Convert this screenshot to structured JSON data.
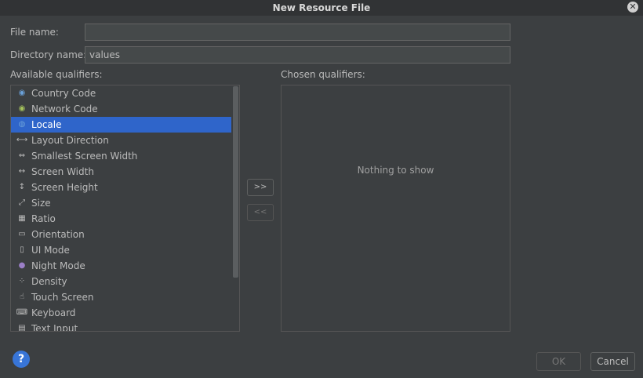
{
  "dialog": {
    "title": "New Resource File",
    "close_glyph": "✕"
  },
  "form": {
    "file_name_label": "File name:",
    "file_name_value": "",
    "directory_label": "Directory name:",
    "directory_value": "values"
  },
  "available": {
    "label": "Available qualifiers:",
    "items": [
      {
        "label": "Country Code",
        "icon": "country-code-icon",
        "glyph": "◉",
        "color": "#6aa0d8"
      },
      {
        "label": "Network Code",
        "icon": "network-code-icon",
        "glyph": "◉",
        "color": "#a5c25c"
      },
      {
        "label": "Locale",
        "icon": "globe-icon",
        "glyph": "◍",
        "color": "#6aa0d8",
        "selected": true
      },
      {
        "label": "Layout Direction",
        "icon": "layout-direction-icon",
        "glyph": "⟷",
        "color": "#bbbbbb"
      },
      {
        "label": "Smallest Screen Width",
        "icon": "smallest-width-icon",
        "glyph": "⇔",
        "color": "#bbbbbb"
      },
      {
        "label": "Screen Width",
        "icon": "screen-width-icon",
        "glyph": "↔",
        "color": "#bbbbbb"
      },
      {
        "label": "Screen Height",
        "icon": "screen-height-icon",
        "glyph": "↕",
        "color": "#bbbbbb"
      },
      {
        "label": "Size",
        "icon": "size-icon",
        "glyph": "⤢",
        "color": "#bbbbbb"
      },
      {
        "label": "Ratio",
        "icon": "ratio-icon",
        "glyph": "▦",
        "color": "#bbbbbb"
      },
      {
        "label": "Orientation",
        "icon": "orientation-icon",
        "glyph": "▭",
        "color": "#bbbbbb"
      },
      {
        "label": "UI Mode",
        "icon": "ui-mode-icon",
        "glyph": "▯",
        "color": "#bbbbbb"
      },
      {
        "label": "Night Mode",
        "icon": "night-mode-icon",
        "glyph": "●",
        "color": "#9b7fc7"
      },
      {
        "label": "Density",
        "icon": "density-icon",
        "glyph": "⁘",
        "color": "#bbbbbb"
      },
      {
        "label": "Touch Screen",
        "icon": "touch-screen-icon",
        "glyph": "☝",
        "color": "#bbbbbb"
      },
      {
        "label": "Keyboard",
        "icon": "keyboard-icon",
        "glyph": "⌨",
        "color": "#bbbbbb"
      },
      {
        "label": "Text Input",
        "icon": "text-input-icon",
        "glyph": "▤",
        "color": "#bbbbbb"
      }
    ]
  },
  "chosen": {
    "label": "Chosen qualifiers:",
    "empty_text": "Nothing to show"
  },
  "transfer": {
    "add_label": ">>",
    "remove_label": "<<"
  },
  "footer": {
    "help_glyph": "?",
    "ok_label": "OK",
    "cancel_label": "Cancel"
  },
  "colors": {
    "background": "#3c3f41",
    "selection": "#2f65ca",
    "help": "#3875d7"
  }
}
